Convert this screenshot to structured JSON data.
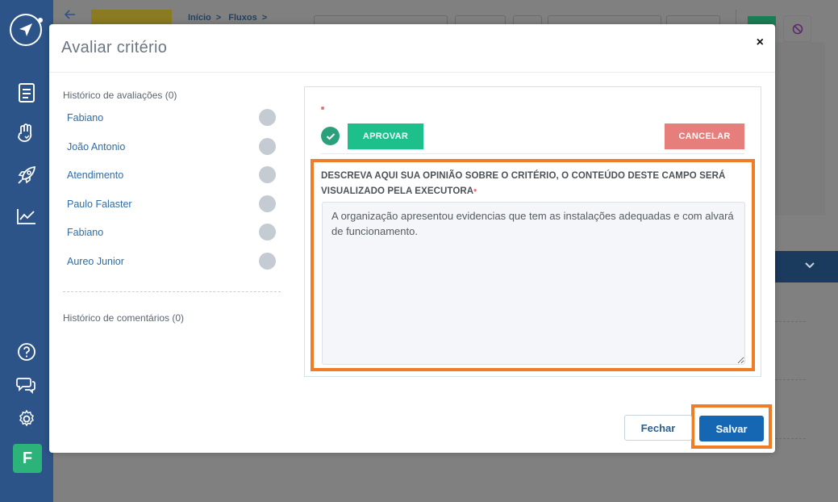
{
  "background": {
    "breadcrumb": [
      "Início",
      "Fluxos"
    ],
    "back_icon": "arrow-left-icon",
    "expand_icon": "chevron-down-icon",
    "block_icon": "block-icon"
  },
  "sidebar": {
    "logo_icon": "compass-logo",
    "items": [
      {
        "icon": "document-icon"
      },
      {
        "icon": "hand-heart-icon"
      },
      {
        "icon": "rocket-icon"
      },
      {
        "icon": "chart-line-icon"
      }
    ],
    "bottom_items": [
      {
        "icon": "help-icon"
      },
      {
        "icon": "chat-icon"
      },
      {
        "icon": "gear-icon"
      }
    ],
    "avatar_initial": "F",
    "avatar_color": "#2bb37a"
  },
  "modal": {
    "title": "Avaliar critério",
    "close_symbol": "×",
    "evaluation_history_label": "Histórico de avaliações (0)",
    "evaluators": [
      {
        "name": "Fabiano"
      },
      {
        "name": "João Antonio"
      },
      {
        "name": "Atendimento"
      },
      {
        "name": "Paulo Falaster"
      },
      {
        "name": "Fabiano"
      },
      {
        "name": "Aureo Junior"
      }
    ],
    "comments_history_label": "Histórico de comentários (0)",
    "approve_label": "APROVAR",
    "cancel_label": "CANCELAR",
    "opinion_label": "DESCREVA AQUI SUA OPINIÃO SOBRE O CRITÉRIO, O CONTEÚDO DESTE CAMPO SERÁ VISUALIZADO PELA EXECUTORA",
    "required_marker": "•",
    "opinion_value": "A organização apresentou evidencias que tem as instalações adequadas e com alvará de funcionamento.",
    "close_button_label": "Fechar",
    "save_button_label": "Salvar"
  },
  "colors": {
    "nav": "#2c5488",
    "approve": "#1dbf8a",
    "cancel": "#e67e7c",
    "save": "#1566b3",
    "highlight": "#f07d25"
  }
}
